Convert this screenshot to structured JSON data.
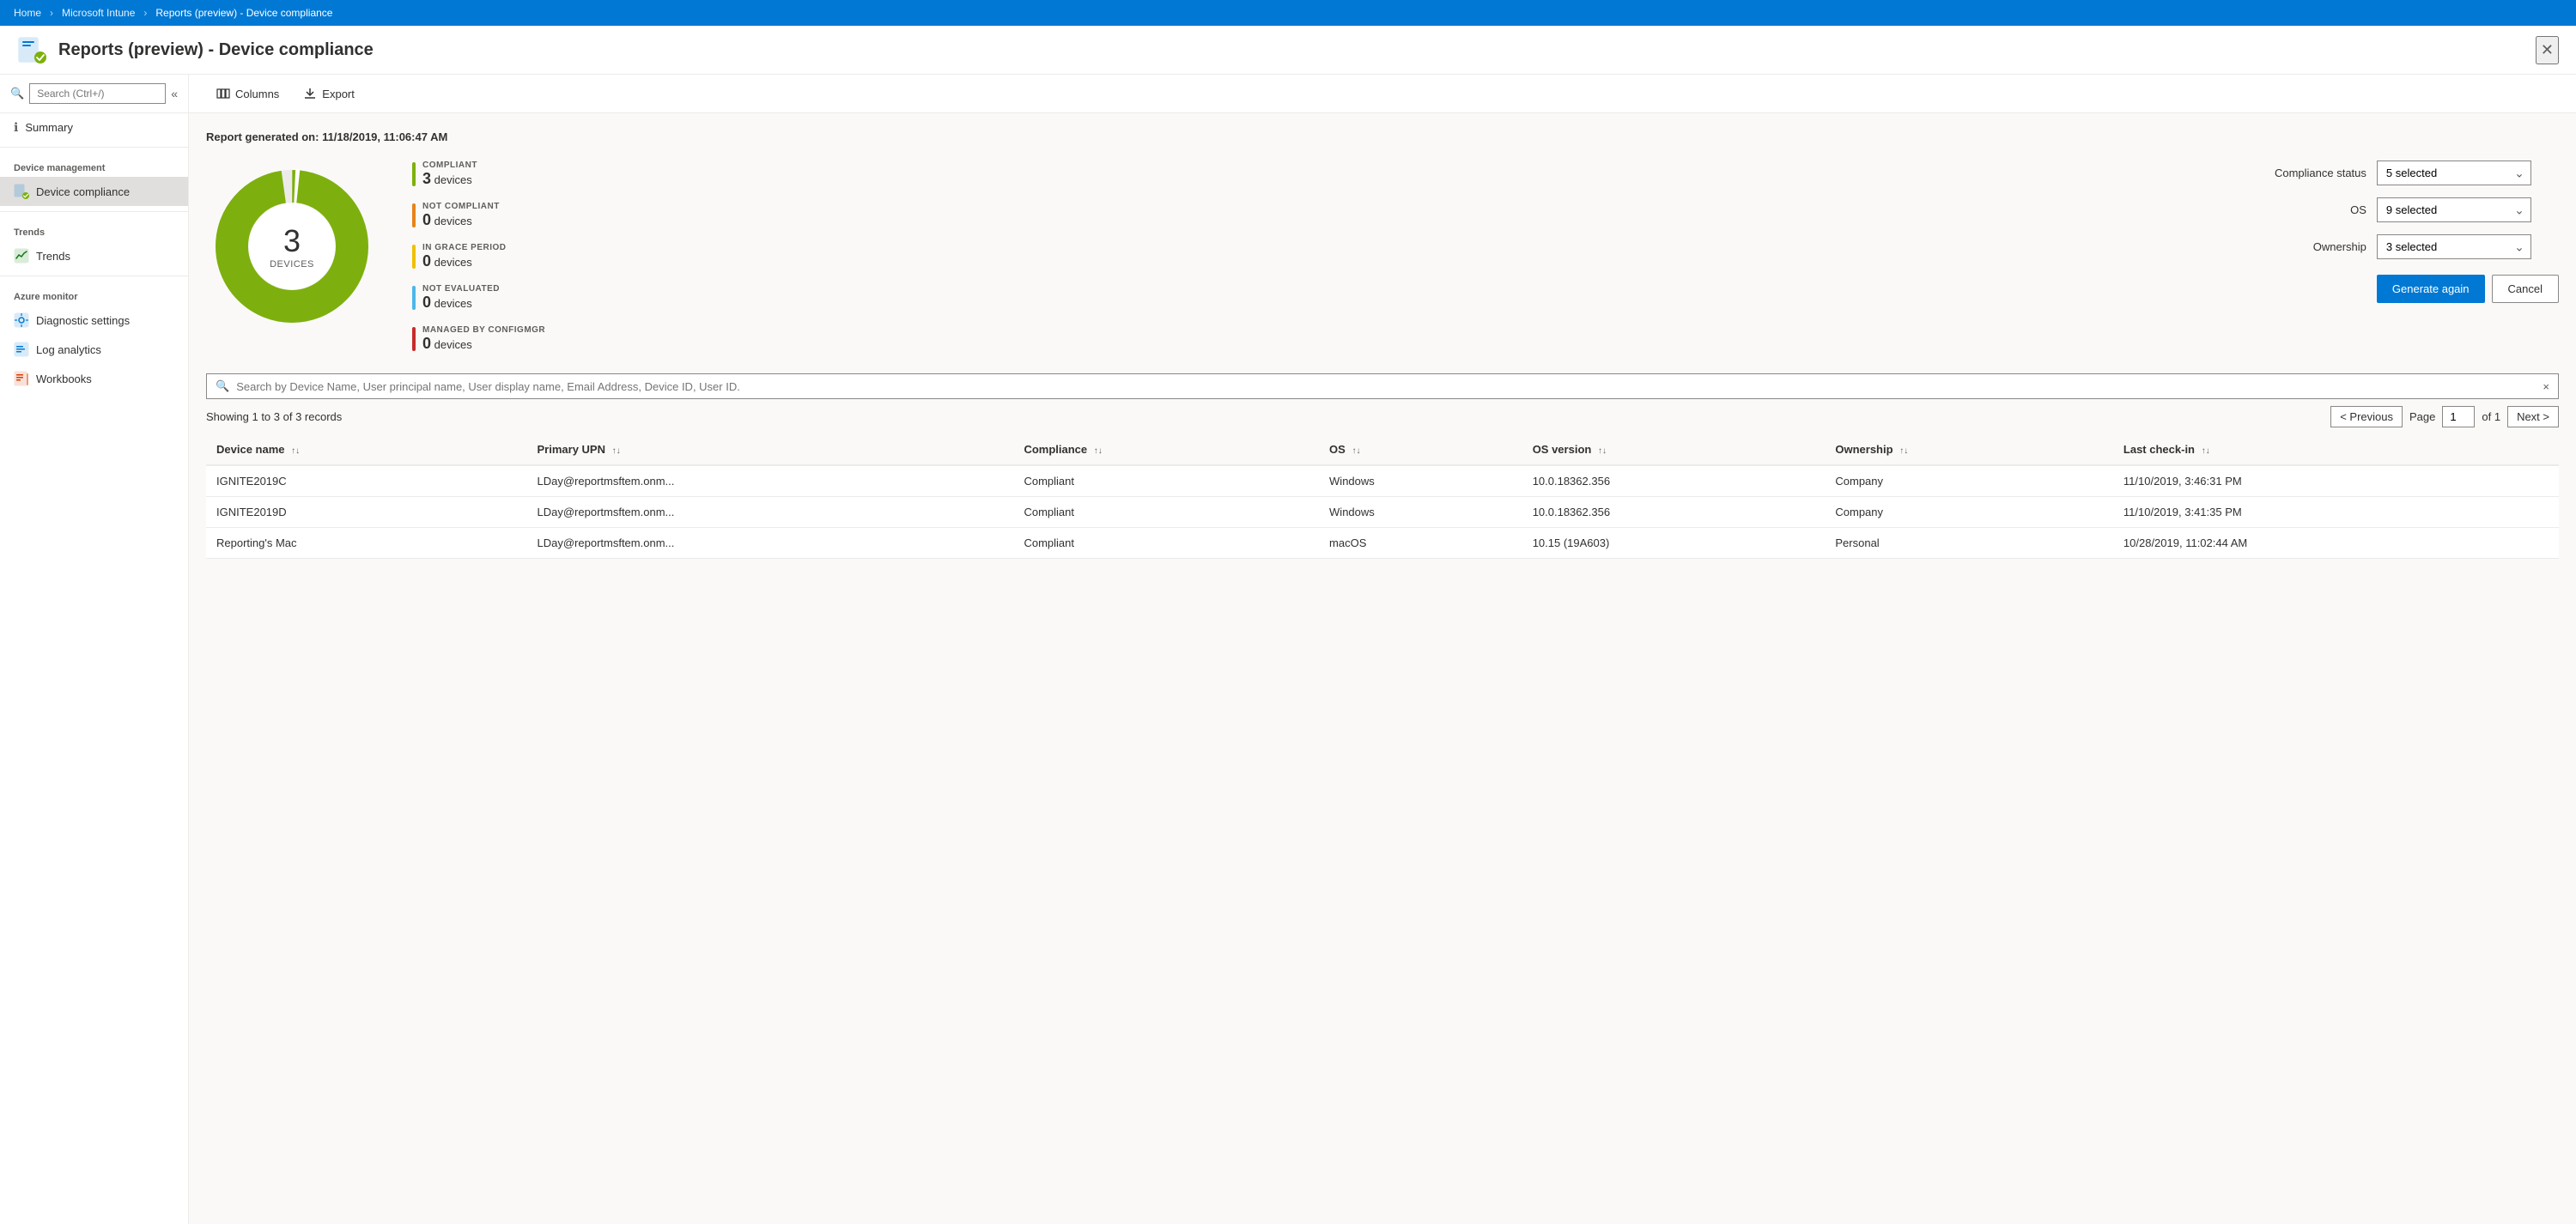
{
  "breadcrumb": {
    "items": [
      "Home",
      "Microsoft Intune",
      "Reports (preview) - Device compliance"
    ]
  },
  "header": {
    "title": "Reports (preview) - Device compliance",
    "icon_alt": "Device compliance icon"
  },
  "sidebar": {
    "search_placeholder": "Search (Ctrl+/)",
    "collapse_icon": "«",
    "summary_label": "Summary",
    "device_management_section": "Device management",
    "device_compliance_label": "Device compliance",
    "trends_section": "Trends",
    "trends_label": "Trends",
    "azure_monitor_section": "Azure monitor",
    "diagnostic_settings_label": "Diagnostic settings",
    "log_analytics_label": "Log analytics",
    "workbooks_label": "Workbooks"
  },
  "toolbar": {
    "columns_label": "Columns",
    "export_label": "Export"
  },
  "report": {
    "generated_label": "Report generated on: 11/18/2019, 11:06:47 AM",
    "donut": {
      "total": "3",
      "unit_label": "DEVICES"
    },
    "legend": [
      {
        "color": "#7db00e",
        "category": "COMPLIANT",
        "value": "3",
        "unit": "devices"
      },
      {
        "color": "#e8821a",
        "category": "NOT COMPLIANT",
        "value": "0",
        "unit": "devices"
      },
      {
        "color": "#f0c000",
        "category": "IN GRACE PERIOD",
        "value": "0",
        "unit": "devices"
      },
      {
        "color": "#4db6e8",
        "category": "NOT EVALUATED",
        "value": "0",
        "unit": "devices"
      },
      {
        "color": "#c72b2b",
        "category": "MANAGED BY CONFIGMGR",
        "value": "0",
        "unit": "devices"
      }
    ],
    "filters": [
      {
        "label": "Compliance status",
        "value": "5 selected"
      },
      {
        "label": "OS",
        "value": "9 selected"
      },
      {
        "label": "Ownership",
        "value": "3 selected"
      }
    ],
    "generate_again_label": "Generate again",
    "cancel_label": "Cancel"
  },
  "search": {
    "placeholder": "Search by Device Name, User principal name, User display name, Email Address, Device ID, User ID.",
    "clear_icon": "×"
  },
  "table": {
    "records_info": "Showing 1 to 3 of 3 records",
    "pagination": {
      "previous_label": "< Previous",
      "page_label": "Page",
      "current_page": "1",
      "of_label": "of 1",
      "next_label": "Next >"
    },
    "columns": [
      {
        "label": "Device name",
        "sortable": true
      },
      {
        "label": "Primary UPN",
        "sortable": true
      },
      {
        "label": "Compliance",
        "sortable": true
      },
      {
        "label": "OS",
        "sortable": true
      },
      {
        "label": "OS version",
        "sortable": true
      },
      {
        "label": "Ownership",
        "sortable": true
      },
      {
        "label": "Last check-in",
        "sortable": true
      }
    ],
    "rows": [
      {
        "device_name": "IGNITE2019C",
        "primary_upn": "LDay@reportmsftem.onm...",
        "compliance": "Compliant",
        "os": "Windows",
        "os_version": "10.0.18362.356",
        "ownership": "Company",
        "last_checkin": "11/10/2019, 3:46:31 PM"
      },
      {
        "device_name": "IGNITE2019D",
        "primary_upn": "LDay@reportmsftem.onm...",
        "compliance": "Compliant",
        "os": "Windows",
        "os_version": "10.0.18362.356",
        "ownership": "Company",
        "last_checkin": "11/10/2019, 3:41:35 PM"
      },
      {
        "device_name": "Reporting's Mac",
        "primary_upn": "LDay@reportmsftem.onm...",
        "compliance": "Compliant",
        "os": "macOS",
        "os_version": "10.15 (19A603)",
        "ownership": "Personal",
        "last_checkin": "10/28/2019, 11:02:44 AM"
      }
    ]
  },
  "colors": {
    "compliant": "#7db00e",
    "not_compliant": "#e8821a",
    "grace_period": "#f0c000",
    "not_evaluated": "#4db6e8",
    "configmgr": "#c72b2b",
    "primary": "#0078d4"
  }
}
